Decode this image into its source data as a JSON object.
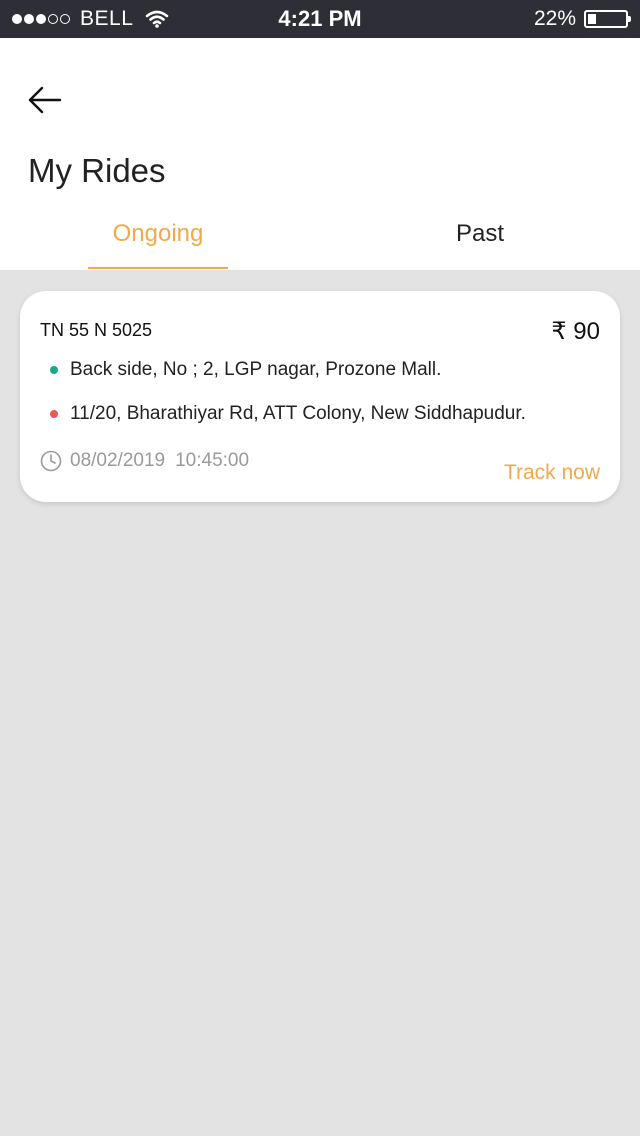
{
  "status_bar": {
    "signal_dots": [
      true,
      true,
      true,
      false,
      false
    ],
    "carrier": "BELL",
    "time": "4:21 PM",
    "battery_pct_text": "22%",
    "battery_level": 0.22
  },
  "header": {
    "back_icon": "arrow-left-icon",
    "title": "My Rides"
  },
  "tabs": {
    "active": "ongoing",
    "ongoing": "Ongoing",
    "past": "Past"
  },
  "ride": {
    "vehicle_number": "TN 55 N 5025",
    "fare": "₹ 90",
    "pickup": "Back side, No ; 2, LGP nagar, Prozone Mall.",
    "drop": "11/20, Bharathiyar Rd, ATT Colony, New Siddhapudur.",
    "date": "08/02/2019",
    "time": "10:45:00",
    "action": "Track now"
  },
  "colors": {
    "accent": "#f2a94a",
    "pickup_dot": "#1aa886",
    "drop_dot": "#ef5555",
    "status_bar_bg": "#2e2f36",
    "background": "#e3e3e3"
  }
}
